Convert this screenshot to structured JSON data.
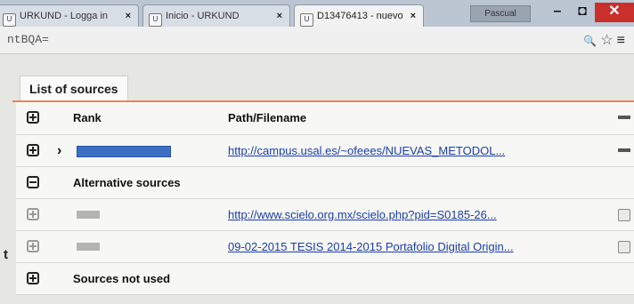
{
  "browser": {
    "tabs": [
      {
        "label": "URKUND - Logga in",
        "close": "×"
      },
      {
        "label": "Inicio - URKUND",
        "close": "×"
      },
      {
        "label": "D13476413 - nuevo",
        "close": "×"
      }
    ],
    "profile_label": "Pascual",
    "window_controls": {
      "minimize": "–",
      "maximize": "◘",
      "close": "✕"
    },
    "url": "ntBQA=",
    "addr_icons": {
      "zoom": "🔍",
      "bookmark": "☆",
      "menu": "≡"
    }
  },
  "panel": {
    "title": "List of sources"
  },
  "table": {
    "headers": {
      "rank": "Rank",
      "path": "Path/Filename"
    },
    "rows": [
      {
        "kind": "source",
        "path": "http://campus.usal.es/~ofeees/NUEVAS_METODOL..."
      }
    ],
    "groups": {
      "alternative": "Alternative sources",
      "not_used": "Sources not used"
    },
    "alt_rows": [
      {
        "path": "http://www.scielo.org.mx/scielo.php?pid=S0185-26..."
      },
      {
        "path": "09-02-2015 TESIS 2014-2015 Portafolio Digital Origin..."
      }
    ]
  },
  "side_letter": "t",
  "colors": {
    "accent_line": "#e08a54",
    "rank_highlight": "#3a6fc4",
    "link": "#1a3fa8"
  }
}
